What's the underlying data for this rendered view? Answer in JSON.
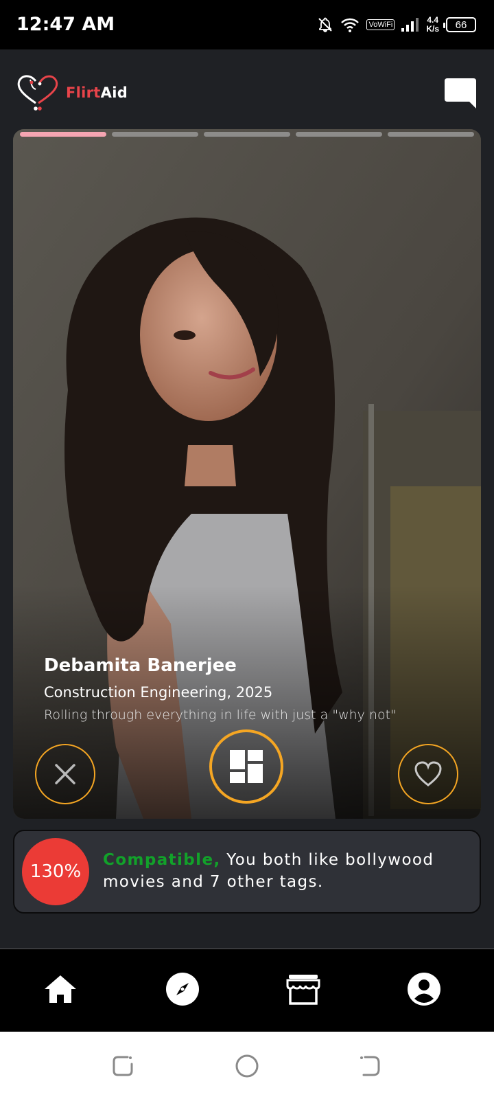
{
  "status_bar": {
    "time": "12:47 AM",
    "vowifi": "VoWiFi",
    "speed_value": "4.4",
    "speed_unit": "K/s",
    "battery": "66"
  },
  "app": {
    "brand_part1": "Flirt",
    "brand_part2": "Aid"
  },
  "card": {
    "photo_count": 5,
    "active_photo_index": 0,
    "name": "Debamita Banerjee",
    "subtitle": "Construction Engineering, 2025",
    "bio": "Rolling through everything in life with just a \"why not\""
  },
  "compatibility": {
    "percent": "130%",
    "highlight": "Compatible,",
    "message": " You both like bollywood movies and 7 other tags."
  },
  "bottom_nav": {
    "items": [
      "home-icon",
      "compass-icon",
      "store-icon",
      "profile-icon"
    ]
  },
  "colors": {
    "accent_orange": "#f5a623",
    "brand_red": "#e8444a",
    "compat_green": "#12a12a",
    "compat_circle": "#eb3b36",
    "progress_active": "#f5a5b2"
  }
}
